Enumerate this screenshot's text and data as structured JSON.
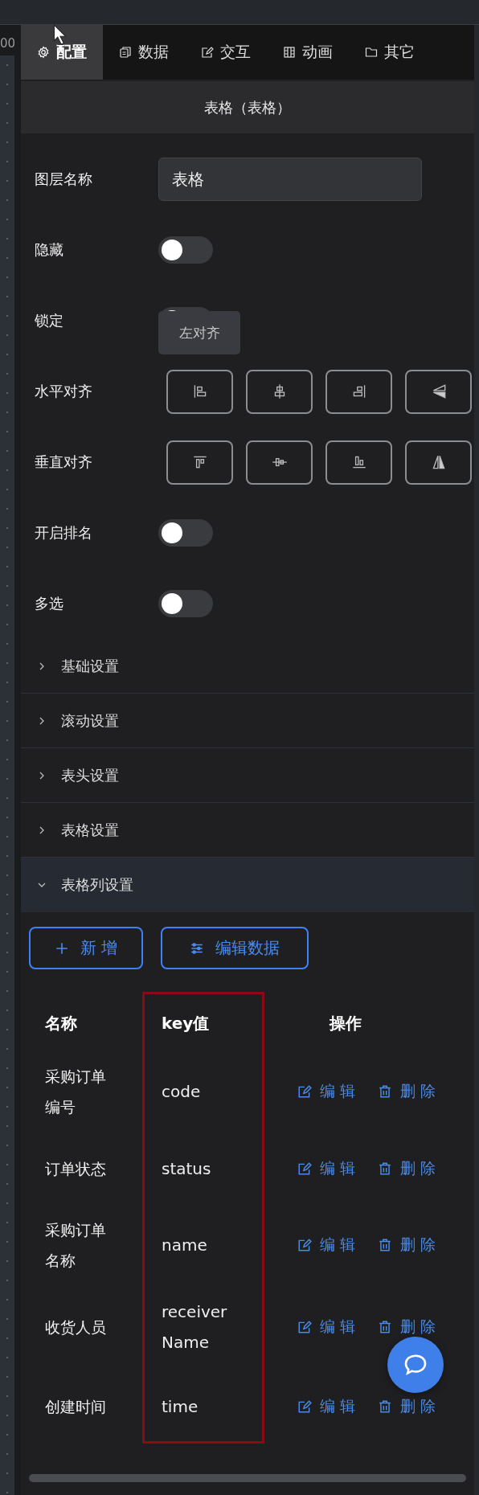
{
  "ruler": {
    "label": "00"
  },
  "tabs": [
    {
      "label": "配置",
      "selected": true
    },
    {
      "label": "数据",
      "selected": false
    },
    {
      "label": "交互",
      "selected": false
    },
    {
      "label": "动画",
      "selected": false
    },
    {
      "label": "其它",
      "selected": false
    }
  ],
  "panel_title": "表格（表格）",
  "settings": [
    {
      "kind": "input",
      "label": "图层名称",
      "value": "表格"
    },
    {
      "kind": "toggle",
      "label": "隐藏",
      "on": false
    },
    {
      "kind": "toggle",
      "label": "锁定",
      "on": false,
      "tooltip": "左对齐"
    },
    {
      "kind": "halign",
      "label": "水平对齐"
    },
    {
      "kind": "valign",
      "label": "垂直对齐"
    },
    {
      "kind": "toggle",
      "label": "开启排名",
      "on": false
    },
    {
      "kind": "toggle",
      "label": "多选",
      "on": false
    }
  ],
  "sections": [
    {
      "label": "基础设置",
      "expanded": false
    },
    {
      "label": "滚动设置",
      "expanded": false
    },
    {
      "label": "表头设置",
      "expanded": false
    },
    {
      "label": "表格设置",
      "expanded": false
    },
    {
      "label": "表格列设置",
      "expanded": true
    }
  ],
  "buttons": [
    "新 增",
    "编辑数据"
  ],
  "table": {
    "columns": [
      {
        "label": "名称",
        "highlighted": false
      },
      {
        "label": "key值",
        "highlighted": true
      },
      {
        "label": "操作",
        "highlighted": false
      }
    ],
    "rows": [
      {
        "name": "采购订单编号",
        "key": "code",
        "edit": "编 辑",
        "delete": "删 除"
      },
      {
        "name": "订单状态",
        "key": "status",
        "edit": "编 辑",
        "delete": "删 除"
      },
      {
        "name": "采购订单名称",
        "key": "name",
        "edit": "编 辑",
        "delete": "删 除"
      },
      {
        "name": "收货人员",
        "key": "receiverName",
        "edit": "编 辑",
        "delete": "删 除"
      },
      {
        "name": "创建时间",
        "key": "time",
        "edit": "编 辑",
        "delete": "删 除"
      }
    ]
  }
}
